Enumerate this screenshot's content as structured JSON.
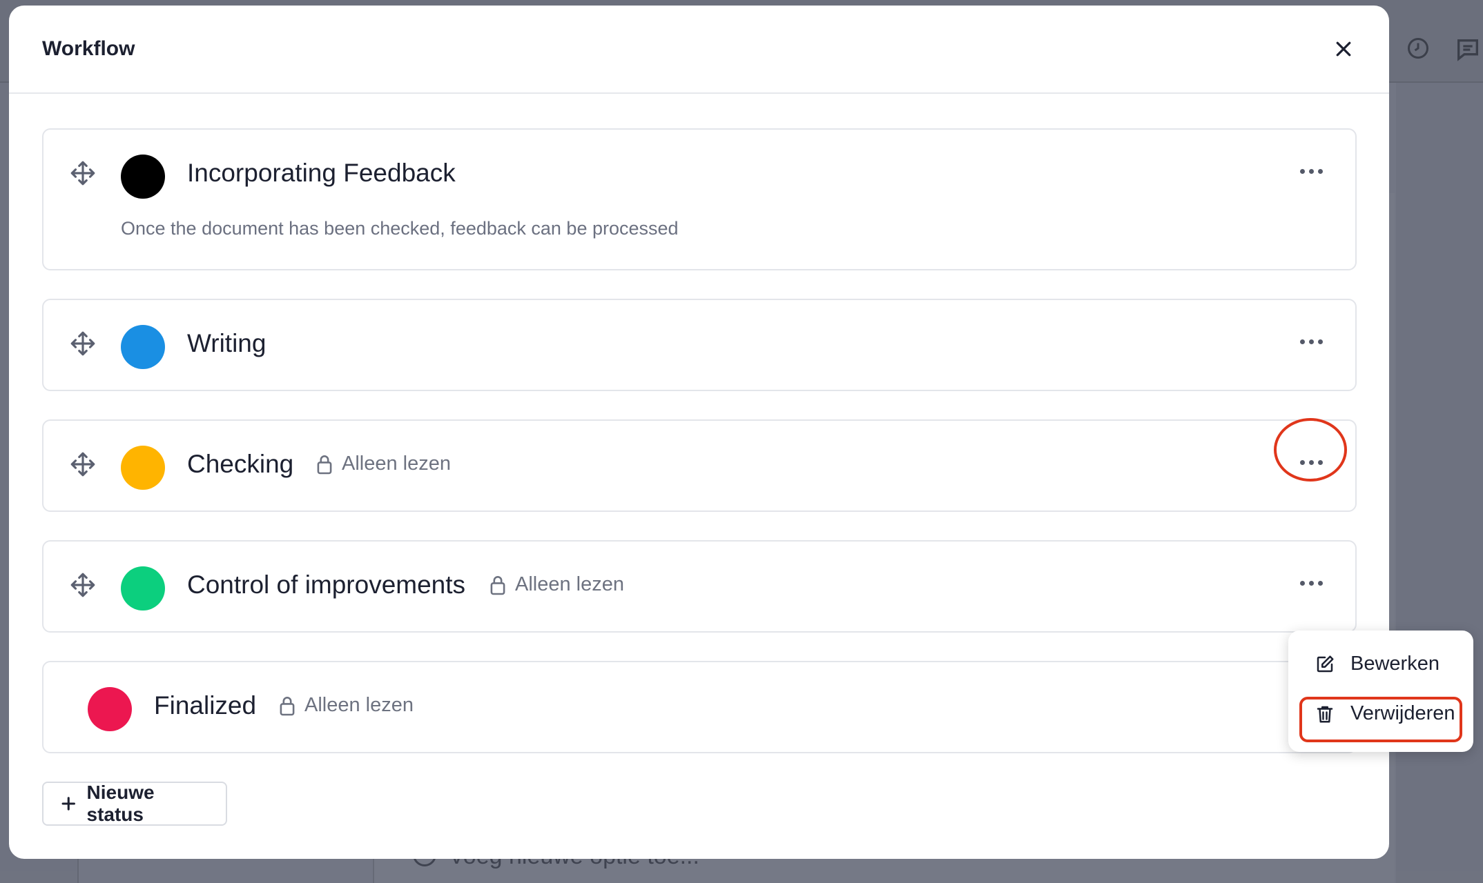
{
  "modal": {
    "title": "Workflow"
  },
  "statuses": [
    {
      "name": "Incorporating Feedback",
      "color": "#000000",
      "description": "Once the document has been checked, feedback can be processed",
      "readonly_label": "",
      "draggable": true
    },
    {
      "name": "Writing",
      "color": "#1a8fe3",
      "description": "",
      "readonly_label": "",
      "draggable": true
    },
    {
      "name": "Checking",
      "color": "#ffb400",
      "description": "",
      "readonly_label": "Alleen lezen",
      "draggable": true
    },
    {
      "name": "Control of improvements",
      "color": "#0ccf7e",
      "description": "",
      "readonly_label": "Alleen lezen",
      "draggable": true
    },
    {
      "name": "Finalized",
      "color": "#ec1750",
      "description": "",
      "readonly_label": "Alleen lezen",
      "draggable": false
    }
  ],
  "new_status_label": "Nieuwe status",
  "context_menu": {
    "edit_label": "Bewerken",
    "delete_label": "Verwijderen"
  },
  "background": {
    "footer_text": "Voeg nieuwe optie toe..."
  },
  "icons": {
    "close": "close-icon",
    "drag": "move-icon",
    "lock": "lock-icon",
    "more": "more-horizontal-icon",
    "edit": "edit-icon",
    "delete": "trash-icon",
    "add": "plus-icon"
  },
  "colors": {
    "highlight": "#e0361b"
  }
}
